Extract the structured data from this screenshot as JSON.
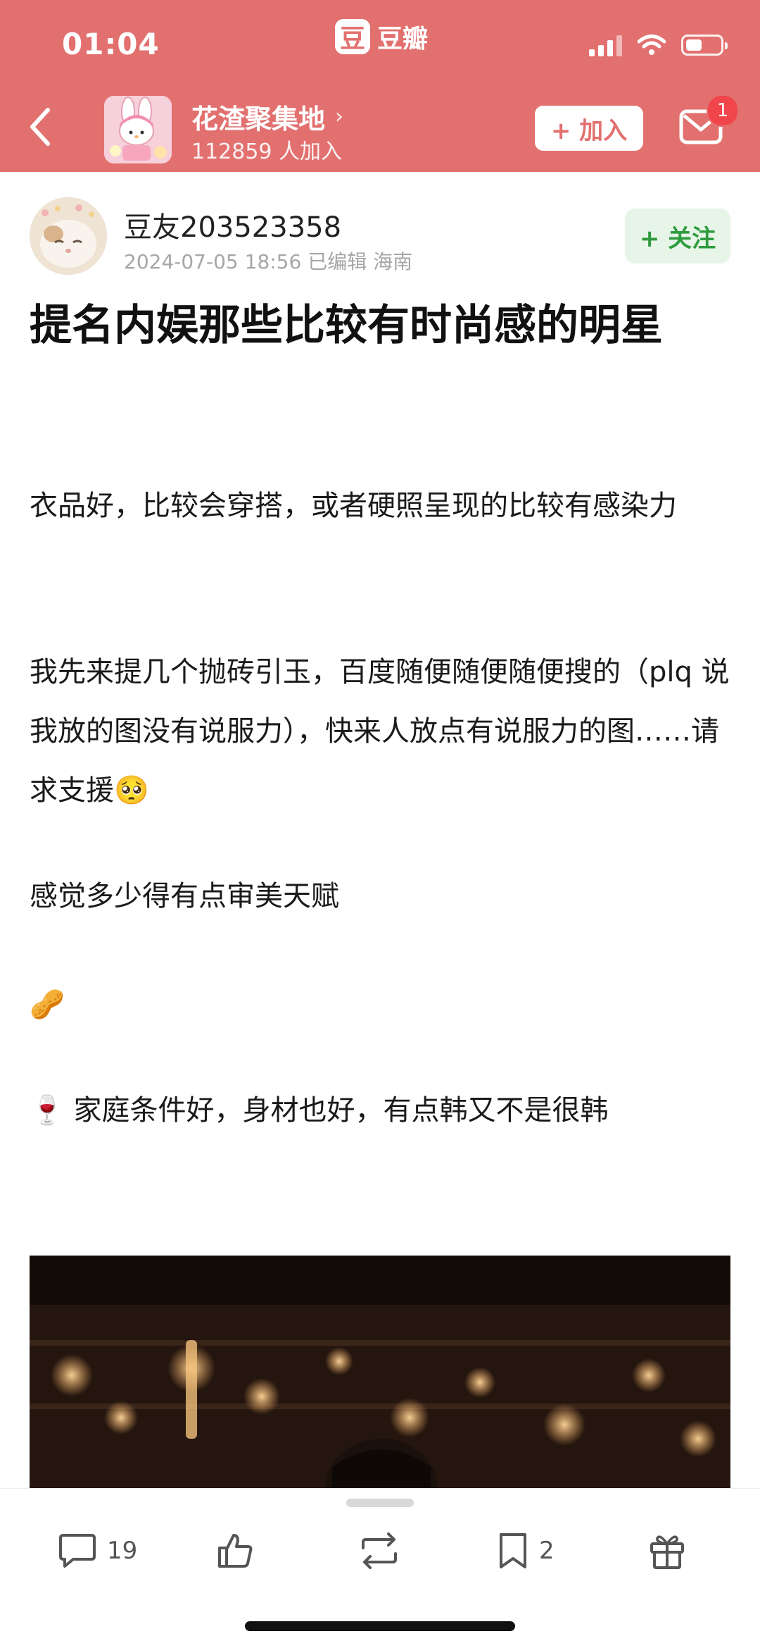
{
  "status_bar": {
    "time": "01:04"
  },
  "app": {
    "logo_glyph": "豆",
    "name": "豆瓣",
    "accent": "#e2706f"
  },
  "group": {
    "name": "花渣聚集地",
    "members": "112859 人加入",
    "join_label": "+ 加入",
    "mail_badge": "1"
  },
  "author": {
    "name": "豆友203523358",
    "meta": "2024-07-05 18:56  已编辑  海南",
    "follow_label": "+ 关注"
  },
  "post": {
    "title": "提名内娱那些比较有时尚感的明星",
    "paragraphs": [
      "衣品好，比较会穿搭，或者硬照呈现的比较有感染力",
      "我先来提几个抛砖引玉，百度随便随便随便搜的（plq 说我放的图没有说服力），快来人放点有说服力的图……请求支援🥺",
      "感觉多少得有点审美天赋",
      "🥜",
      "🍷 家庭条件好，身材也好，有点韩又不是很韩"
    ]
  },
  "bottom_bar": {
    "comment_count": "19",
    "collect_count": "2",
    "icons": [
      "comment-icon",
      "like-icon",
      "repost-icon",
      "bookmark-icon",
      "gift-icon"
    ]
  }
}
